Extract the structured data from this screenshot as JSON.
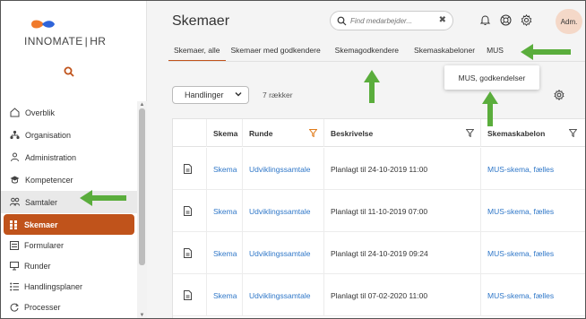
{
  "app": {
    "brand_left": "INNOMATE",
    "brand_sep": "|",
    "brand_right": "HR"
  },
  "sidebar": {
    "items": [
      {
        "label": "Overblik",
        "icon": "home-icon"
      },
      {
        "label": "Organisation",
        "icon": "org-icon"
      },
      {
        "label": "Administration",
        "icon": "people-icon"
      },
      {
        "label": "Kompetencer",
        "icon": "graduation-icon"
      },
      {
        "label": "Samtaler",
        "icon": "conversation-icon"
      }
    ],
    "sub_items": [
      {
        "label": "Skemaer",
        "icon": "grid-icon"
      },
      {
        "label": "Formularer",
        "icon": "form-icon"
      },
      {
        "label": "Runder",
        "icon": "rounds-icon"
      },
      {
        "label": "Handlingsplaner",
        "icon": "list-icon"
      },
      {
        "label": "Processer",
        "icon": "process-icon"
      }
    ]
  },
  "header": {
    "title": "Skemaer",
    "search_placeholder": "Find medarbejder...",
    "avatar_initials": "Adm."
  },
  "tabs": [
    {
      "label": "Skemaer, alle",
      "active": true
    },
    {
      "label": "Skemaer med godkendere",
      "active": false
    },
    {
      "label": "Skemagodkendere",
      "active": false
    },
    {
      "label": "Skemaskabeloner",
      "active": false
    },
    {
      "label": "MUS",
      "active": false
    }
  ],
  "mus_dropdown": {
    "item": "MUS, godkendelser"
  },
  "toolbar": {
    "actions_label": "Handlinger",
    "row_count": "7 rækker"
  },
  "table": {
    "columns": [
      "",
      "Skema",
      "Runde",
      "Beskrivelse",
      "Skemaskabelon"
    ],
    "rows": [
      {
        "skema": "Skema",
        "runde": "Udviklingssamtale",
        "beskrivelse": "Planlagt til 24-10-2019 11:00",
        "skabelon": "MUS-skema, fælles"
      },
      {
        "skema": "Skema",
        "runde": "Udviklingssamtale",
        "beskrivelse": "Planlagt til 11-10-2019 07:00",
        "skabelon": "MUS-skema, fælles"
      },
      {
        "skema": "Skema",
        "runde": "Udviklingssamtale",
        "beskrivelse": "Planlagt til 24-10-2019 09:24",
        "skabelon": "MUS-skema, fælles"
      },
      {
        "skema": "Skema",
        "runde": "Udviklingssamtale",
        "beskrivelse": "Planlagt til 07-02-2020 11:00",
        "skabelon": "MUS-skema, fælles"
      }
    ]
  },
  "colors": {
    "accent": "#c0531b",
    "link": "#2f77c8",
    "arrow": "#5aad3c",
    "filter_active": "#e07b1a"
  }
}
